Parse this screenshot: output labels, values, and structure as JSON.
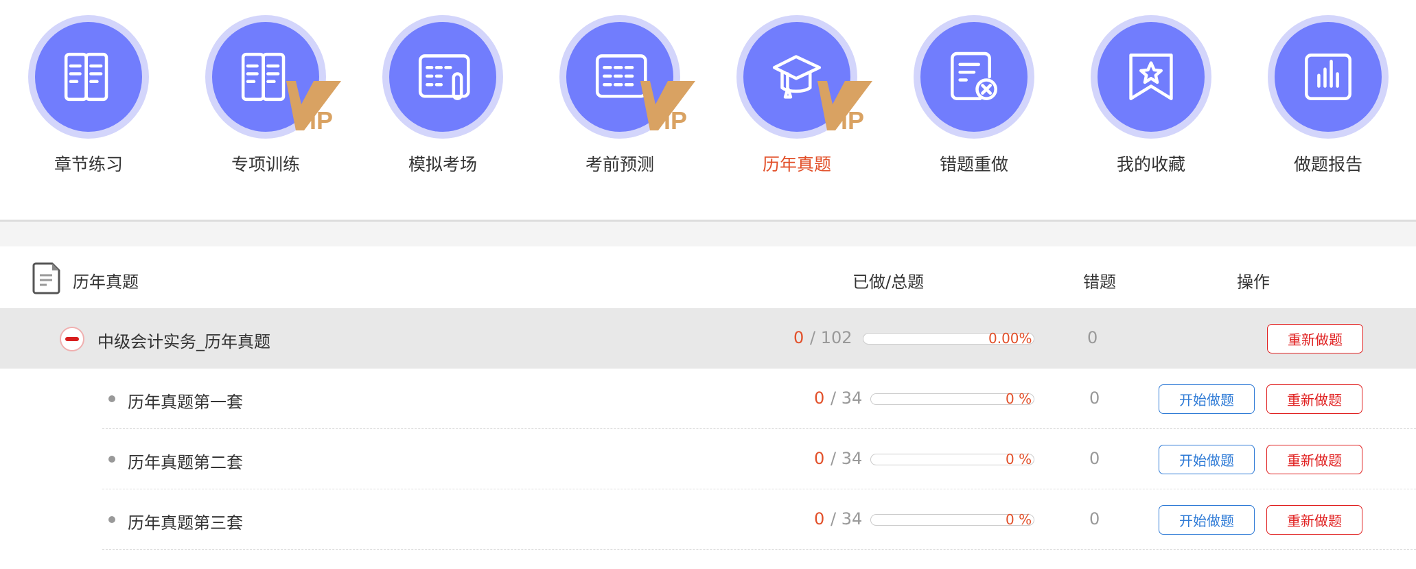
{
  "nav": [
    {
      "label": "章节练习",
      "icon": "book-icon",
      "vip": false,
      "active": false
    },
    {
      "label": "专项训练",
      "icon": "book-icon",
      "vip": true,
      "active": false
    },
    {
      "label": "模拟考场",
      "icon": "exam-sheet-icon",
      "vip": false,
      "active": false
    },
    {
      "label": "考前预测",
      "icon": "table-icon",
      "vip": true,
      "active": false
    },
    {
      "label": "历年真题",
      "icon": "graduation-cap-icon",
      "vip": true,
      "active": true
    },
    {
      "label": "错题重做",
      "icon": "wrong-doc-icon",
      "vip": false,
      "active": false
    },
    {
      "label": "我的收藏",
      "icon": "bookmark-star-icon",
      "vip": false,
      "active": false
    },
    {
      "label": "做题报告",
      "icon": "bar-chart-icon",
      "vip": false,
      "active": false
    }
  ],
  "vip_text": "IP",
  "header": {
    "title": "历年真题",
    "col_progress": "已做/总题",
    "col_wrong": "错题",
    "col_action": "操作"
  },
  "parent": {
    "name": "中级会计实务_历年真题",
    "done": "0",
    "total": "/ 102",
    "percent": "0.00%",
    "progress": 0,
    "wrong": "0",
    "redo": "重新做题"
  },
  "children": [
    {
      "name": "历年真题第一套",
      "done": "0",
      "total": "/ 34",
      "percent": "0 %",
      "progress": 0,
      "wrong": "0",
      "start": "开始做题",
      "redo": "重新做题"
    },
    {
      "name": "历年真题第二套",
      "done": "0",
      "total": "/ 34",
      "percent": "0 %",
      "progress": 0,
      "wrong": "0",
      "start": "开始做题",
      "redo": "重新做题"
    },
    {
      "name": "历年真题第三套",
      "done": "0",
      "total": "/ 34",
      "percent": "0 %",
      "progress": 0,
      "wrong": "0",
      "start": "开始做题",
      "redo": "重新做题"
    }
  ],
  "colors": {
    "accent": "#717dfd",
    "active": "#e2502a",
    "vip": "#d9a262",
    "red": "#e02020",
    "blue": "#2f7bd6"
  }
}
